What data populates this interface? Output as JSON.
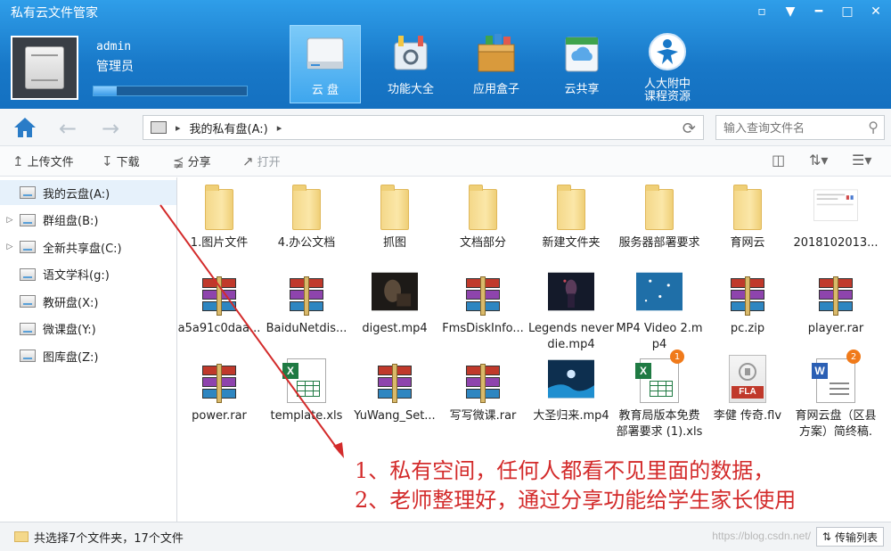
{
  "app": {
    "title": "私有云文件管家"
  },
  "window_controls": [
    "msg-icon",
    "menu-icon",
    "minimize-icon",
    "maximize-icon",
    "close-icon"
  ],
  "user": {
    "name": "admin",
    "role": "管理员",
    "quota_fill": 0.15
  },
  "nav_tabs": [
    {
      "label": "云 盘",
      "icon": "cloud-disk-icon",
      "active": true
    },
    {
      "label": "功能大全",
      "icon": "toolbox-icon"
    },
    {
      "label": "应用盒子",
      "icon": "app-box-icon"
    },
    {
      "label": "云共享",
      "icon": "cloud-share-icon"
    },
    {
      "label": "人大附中\n课程资源",
      "icon": "school-logo-icon"
    }
  ],
  "address": {
    "path": "我的私有盘(A:)",
    "search_placeholder": "输入查询文件名"
  },
  "toolbar": {
    "upload": "上传文件",
    "download": "下载",
    "share": "分享",
    "open": "打开"
  },
  "sidebar": {
    "items": [
      {
        "label": "我的云盘(A:)",
        "expandable": false,
        "selected": true
      },
      {
        "label": "群组盘(B:)",
        "expandable": true
      },
      {
        "label": "全新共享盘(C:)",
        "expandable": true
      },
      {
        "label": "语文学科(g:)",
        "expandable": false
      },
      {
        "label": "教研盘(X:)",
        "expandable": false
      },
      {
        "label": "微课盘(Y:)",
        "expandable": false
      },
      {
        "label": "图库盘(Z:)",
        "expandable": false
      }
    ]
  },
  "files": [
    {
      "name": "1.图片文件",
      "type": "folder"
    },
    {
      "name": "4.办公文档",
      "type": "folder"
    },
    {
      "name": "抓图",
      "type": "folder"
    },
    {
      "name": "文档部分",
      "type": "folder"
    },
    {
      "name": "新建文件夹",
      "type": "folder"
    },
    {
      "name": "服务器部署要求",
      "type": "folder"
    },
    {
      "name": "育网云",
      "type": "folder"
    },
    {
      "name": "2018102013...",
      "type": "image"
    },
    {
      "name": "a5a91c0daa...",
      "type": "rar"
    },
    {
      "name": "BaiduNetdis...",
      "type": "rar"
    },
    {
      "name": "digest.mp4",
      "type": "video-dark"
    },
    {
      "name": "FmsDiskInfo...",
      "type": "rar"
    },
    {
      "name": "Legends never die.mp4",
      "type": "video-legends"
    },
    {
      "name": "MP4 Video 2.mp4",
      "type": "video-blue"
    },
    {
      "name": "pc.zip",
      "type": "rar"
    },
    {
      "name": "player.rar",
      "type": "rar"
    },
    {
      "name": "power.rar",
      "type": "rar"
    },
    {
      "name": "template.xls",
      "type": "xls"
    },
    {
      "name": "YuWang_Set...",
      "type": "rar"
    },
    {
      "name": "写写微课.rar",
      "type": "rar"
    },
    {
      "name": "大圣归来.mp4",
      "type": "video-monkey"
    },
    {
      "name": "教育局版本免费部署要求 (1).xls",
      "type": "xls",
      "badge": "1"
    },
    {
      "name": "李健 传奇.flv",
      "type": "flv",
      "flv_label": "FLA"
    },
    {
      "name": "育网云盘（区县方案）简终稿.",
      "type": "doc",
      "badge": "2"
    }
  ],
  "annotation": {
    "line1": "1、私有空间，任何人都看不见里面的数据，",
    "line2": "2、老师整理好，通过分享功能给学生家长使用"
  },
  "status": {
    "text": "共选择7个文件夹，17个文件",
    "transfer": "传输列表",
    "watermark": "https://blog.csdn.net/"
  },
  "colors": {
    "banner": "#1878c8",
    "annotation": "#d32b2b",
    "selected_row": "#e6f1fb"
  }
}
